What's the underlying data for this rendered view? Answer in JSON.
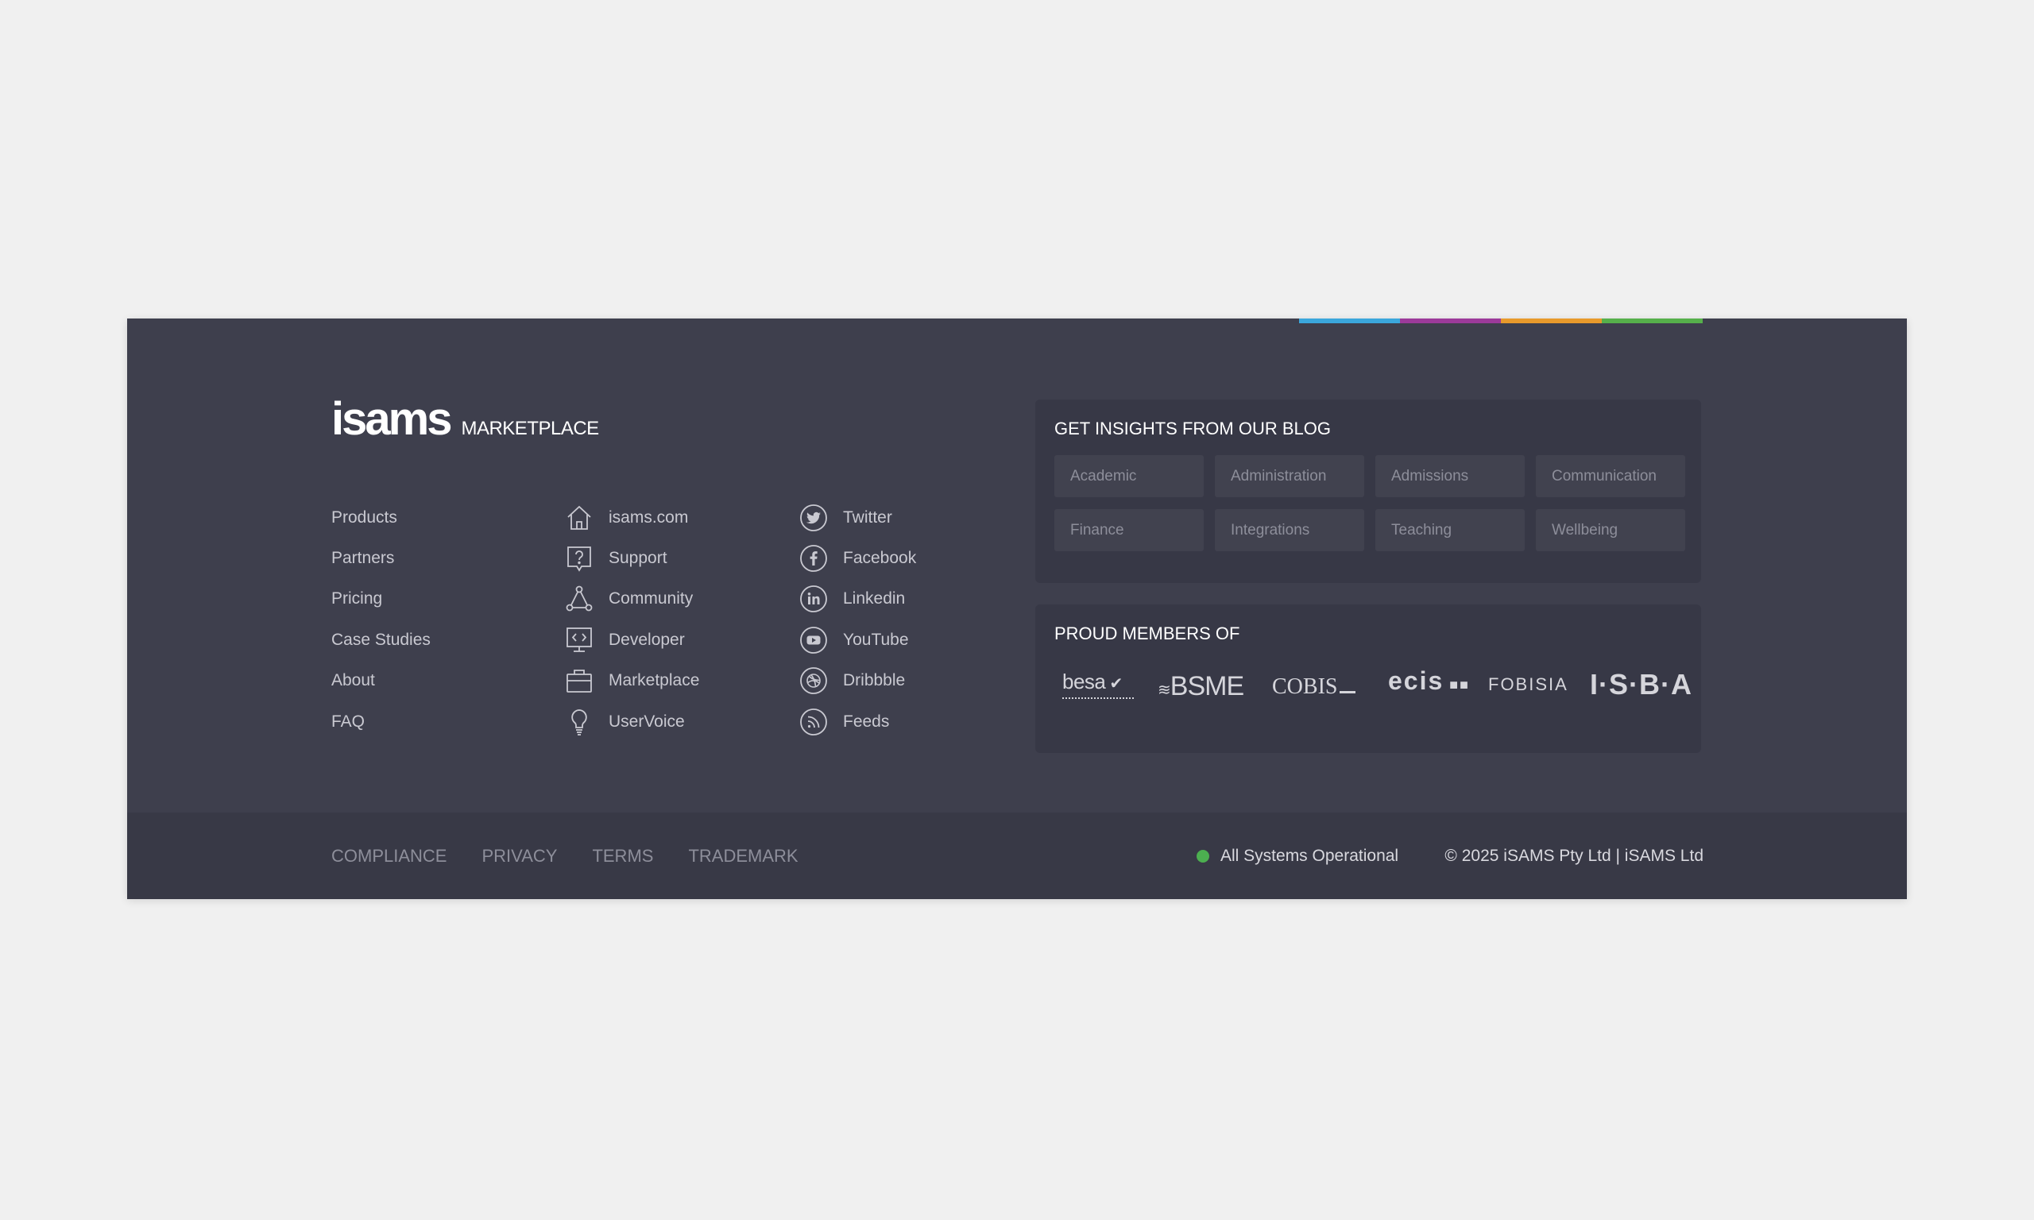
{
  "accent_colors": [
    "#3ba7dc",
    "#9c3a9a",
    "#e89a2c",
    "#56b04b"
  ],
  "brand": {
    "wordmark": "isams",
    "sub": "MARKETPLACE"
  },
  "nav": {
    "site": [
      "Products",
      "Partners",
      "Pricing",
      "Case Studies",
      "About",
      "FAQ"
    ],
    "resources": [
      {
        "label": "isams.com",
        "icon": "home-icon"
      },
      {
        "label": "Support",
        "icon": "help-icon"
      },
      {
        "label": "Community",
        "icon": "community-icon"
      },
      {
        "label": "Developer",
        "icon": "developer-icon"
      },
      {
        "label": "Marketplace",
        "icon": "briefcase-icon"
      },
      {
        "label": "UserVoice",
        "icon": "lightbulb-icon"
      }
    ],
    "social": [
      {
        "label": "Twitter",
        "icon": "twitter-icon"
      },
      {
        "label": "Facebook",
        "icon": "facebook-icon"
      },
      {
        "label": "Linkedin",
        "icon": "linkedin-icon"
      },
      {
        "label": "YouTube",
        "icon": "youtube-icon"
      },
      {
        "label": "Dribbble",
        "icon": "dribbble-icon"
      },
      {
        "label": "Feeds",
        "icon": "rss-icon"
      }
    ]
  },
  "blog": {
    "title": "GET INSIGHTS FROM OUR BLOG",
    "tags": [
      "Academic",
      "Administration",
      "Admissions",
      "Communication",
      "Finance",
      "Integrations",
      "Teaching",
      "Wellbeing"
    ]
  },
  "members": {
    "title": "PROUD MEMBERS OF",
    "orgs": [
      "besa",
      "BSME",
      "COBIS",
      "ecis",
      "FOBISIA",
      "I·S·B·A"
    ]
  },
  "bottom": {
    "links": [
      "COMPLIANCE",
      "PRIVACY",
      "TERMS",
      "TRADEMARK"
    ],
    "status": "All Systems Operational",
    "copyright": "© 2025 iSAMS Pty Ltd | iSAMS Ltd"
  }
}
